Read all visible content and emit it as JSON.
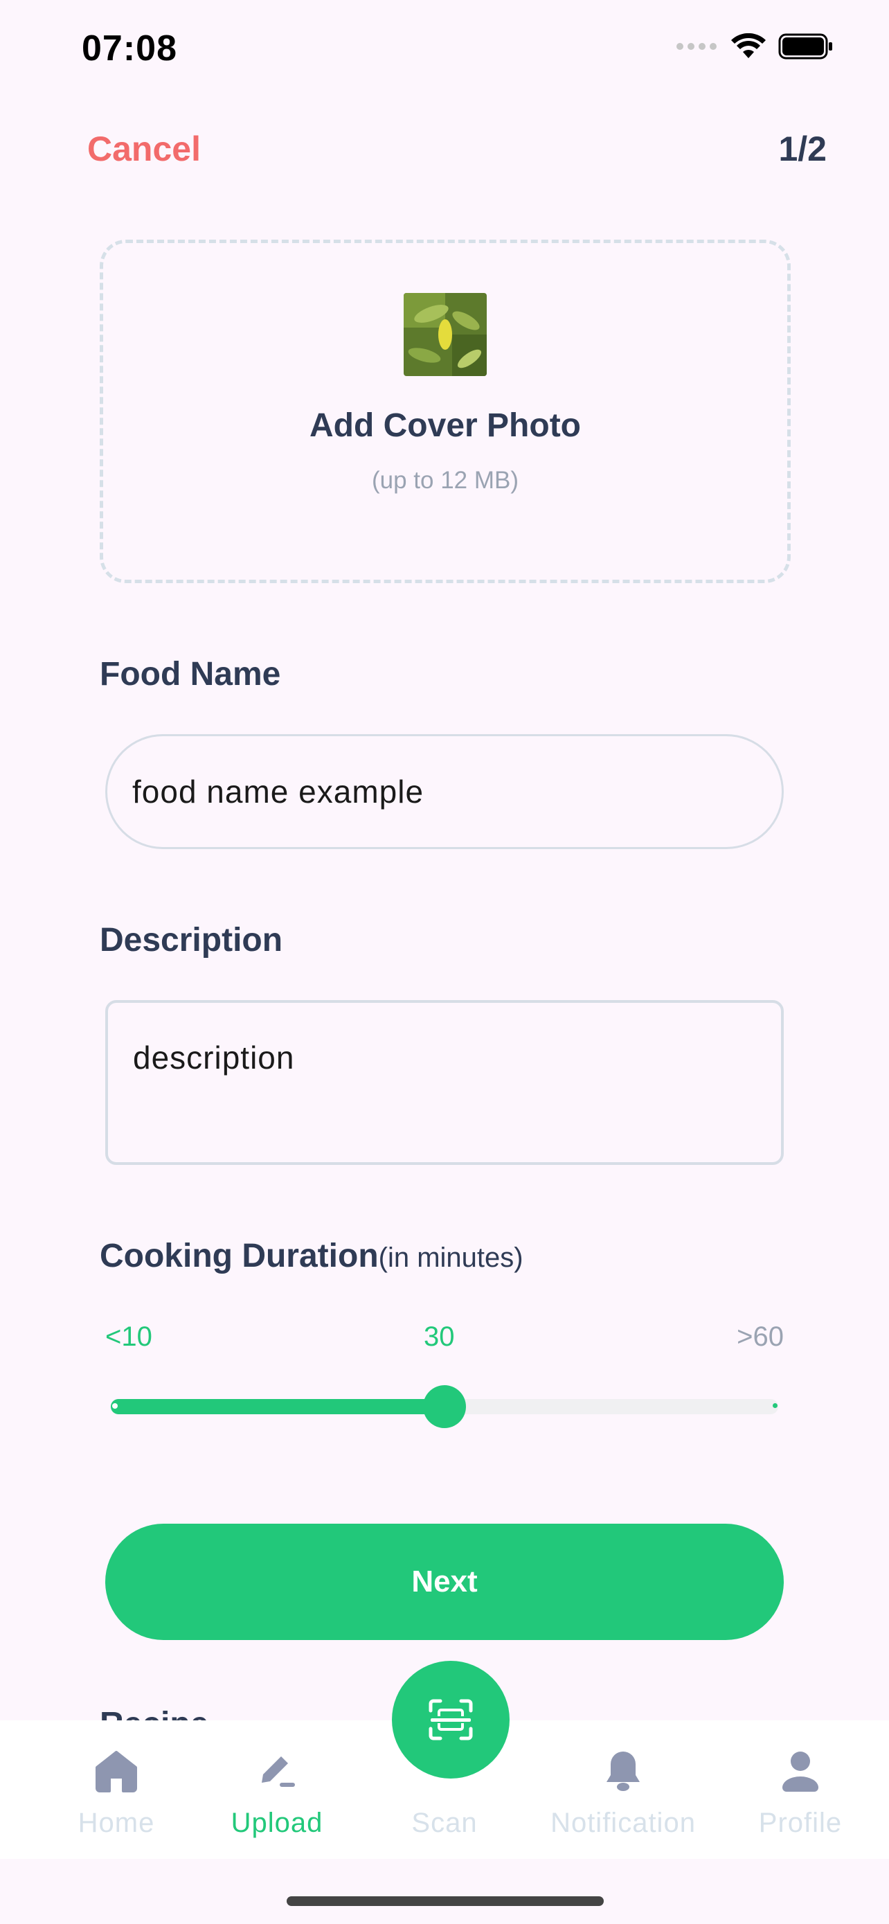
{
  "status_bar": {
    "time": "07:08"
  },
  "header": {
    "cancel_label": "Cancel",
    "step": "1/2"
  },
  "cover": {
    "title": "Add Cover Photo",
    "subtitle": "(up to 12 MB)"
  },
  "food_name": {
    "label": "Food Name",
    "value": "food name example"
  },
  "description": {
    "label": "Description",
    "value": "description"
  },
  "duration": {
    "label": "Cooking Duration",
    "unit": "(in minutes)",
    "min_label": "<10",
    "value": "30",
    "max_label": ">60",
    "fraction": 0.5
  },
  "next_label": "Next",
  "next_section_peek": "Recipe",
  "nav": {
    "items": [
      {
        "label": "Home",
        "icon": "home-icon"
      },
      {
        "label": "Upload",
        "icon": "edit-icon",
        "active": true
      },
      {
        "label": "Scan",
        "icon": "scan-icon"
      },
      {
        "label": "Notification",
        "icon": "bell-icon"
      },
      {
        "label": "Profile",
        "icon": "user-icon"
      }
    ]
  },
  "colors": {
    "accent": "#22c87a",
    "danger": "#f26b6b",
    "text": "#2f3b55"
  }
}
